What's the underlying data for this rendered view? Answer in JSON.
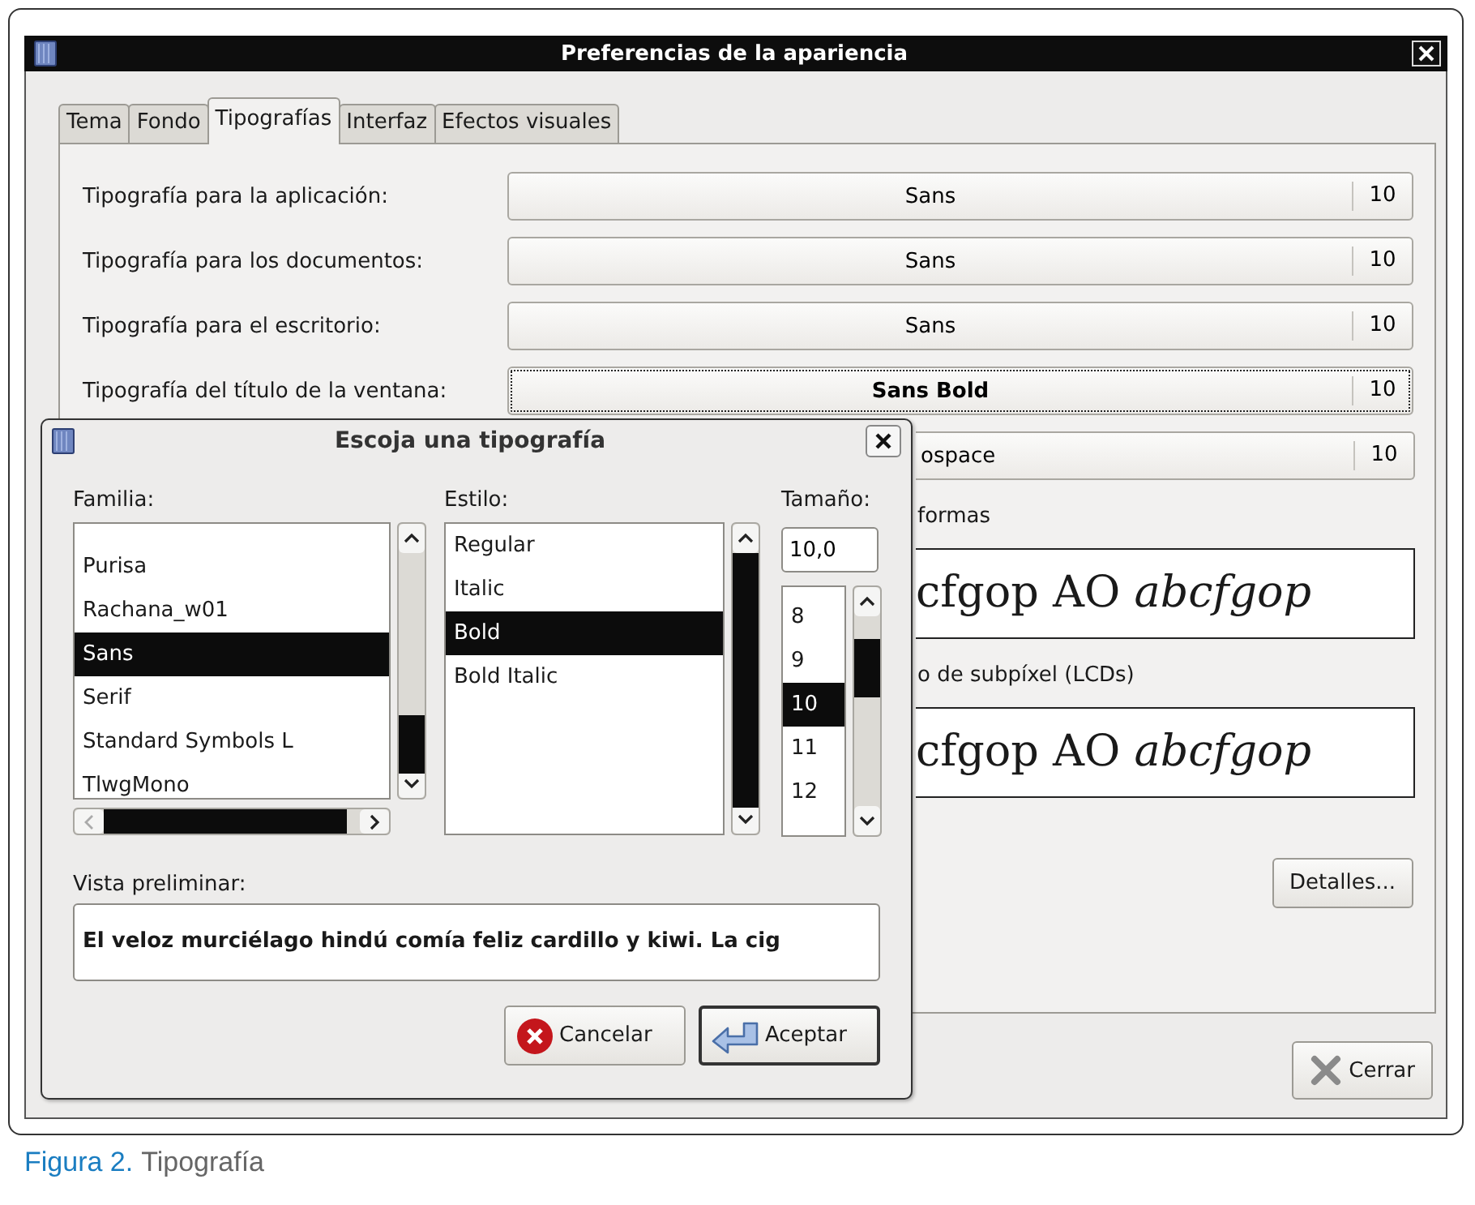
{
  "window": {
    "title": "Preferencias de la apariencia"
  },
  "tabs": [
    {
      "label": "Tema",
      "selected": false
    },
    {
      "label": "Fondo",
      "selected": false
    },
    {
      "label": "Tipografías",
      "selected": true
    },
    {
      "label": "Interfaz",
      "selected": false
    },
    {
      "label": "Efectos visuales",
      "selected": false
    }
  ],
  "font_rows": [
    {
      "label": "Tipografía para la aplicación:",
      "font": "Sans",
      "size": "10",
      "bold": false,
      "focused": false
    },
    {
      "label": "Tipografía para los documentos:",
      "font": "Sans",
      "size": "10",
      "bold": false,
      "focused": false
    },
    {
      "label": "Tipografía para el escritorio:",
      "font": "Sans",
      "size": "10",
      "bold": false,
      "focused": false
    },
    {
      "label": "Tipografía del título de la ventana:",
      "font": "Sans Bold",
      "size": "10",
      "bold": true,
      "focused": true
    },
    {
      "font": "ospace",
      "size": "10",
      "bold": false,
      "focused": false
    }
  ],
  "rendering": [
    {
      "label": "formas",
      "sample": "cfgop AO *abcfgop*"
    },
    {
      "label": "o de subpíxel (LCDs)",
      "sample": "cfgop AO *abcfgop*"
    }
  ],
  "details_button": "Detalles...",
  "close_button": "Cerrar",
  "font_dialog": {
    "title": "Escoja una tipografía",
    "family_label": "Familia:",
    "families": [
      {
        "name": "Purisa",
        "selected": false
      },
      {
        "name": "Rachana_w01",
        "selected": false
      },
      {
        "name": "Sans",
        "selected": true
      },
      {
        "name": "Serif",
        "selected": false
      },
      {
        "name": "Standard Symbols L",
        "selected": false
      },
      {
        "name": "TlwgMono",
        "selected": false
      }
    ],
    "style_label": "Estilo:",
    "styles": [
      {
        "name": "Regular",
        "selected": false
      },
      {
        "name": "Italic",
        "selected": false
      },
      {
        "name": "Bold",
        "selected": true
      },
      {
        "name": "Bold Italic",
        "selected": false
      }
    ],
    "size_label": "Tamaño:",
    "size_value": "10,0",
    "sizes": [
      {
        "name": "8",
        "selected": false
      },
      {
        "name": "9",
        "selected": false
      },
      {
        "name": "10",
        "selected": true
      },
      {
        "name": "11",
        "selected": false
      },
      {
        "name": "12",
        "selected": false
      }
    ],
    "preview_label": "Vista preliminar:",
    "preview_text": "El veloz murciélago hindú comía feliz cardillo y kiwi. La cig",
    "buttons": [
      {
        "kind": "cancel",
        "label": "Cancelar",
        "default": false
      },
      {
        "kind": "ok",
        "label": "Aceptar",
        "default": true
      }
    ]
  },
  "caption": {
    "label": "Figura 2.",
    "text": "Tipografía"
  }
}
